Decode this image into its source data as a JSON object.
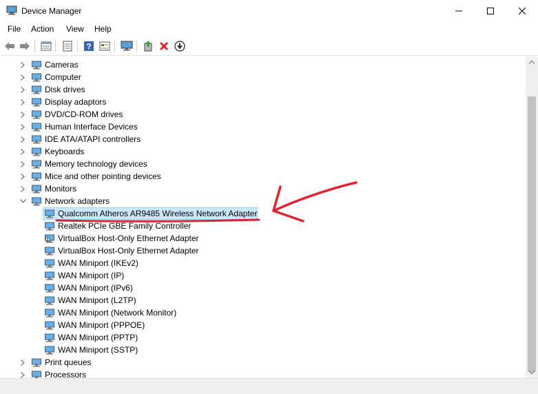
{
  "window": {
    "title": "Device Manager"
  },
  "menu": [
    "File",
    "Action",
    "View",
    "Help"
  ],
  "toolbar": [
    "back-icon",
    "forward-icon",
    "properties-icon",
    "console-icon",
    "help-icon",
    "view-icon",
    "monitor-icon",
    "update-driver-icon",
    "uninstall-icon",
    "disable-icon"
  ],
  "tree": {
    "categories_top": [
      {
        "label": "Cameras",
        "icon": "camera-icon"
      },
      {
        "label": "Computer",
        "icon": "computer-icon"
      },
      {
        "label": "Disk drives",
        "icon": "disk-icon"
      },
      {
        "label": "Display adaptors",
        "icon": "display-icon"
      },
      {
        "label": "DVD/CD-ROM drives",
        "icon": "dvd-icon"
      },
      {
        "label": "Human Interface Devices",
        "icon": "hid-icon"
      },
      {
        "label": "IDE ATA/ATAPI controllers",
        "icon": "ide-icon"
      },
      {
        "label": "Keyboards",
        "icon": "keyboard-icon"
      },
      {
        "label": "Memory technology devices",
        "icon": "memory-icon"
      },
      {
        "label": "Mice and other pointing devices",
        "icon": "mouse-icon"
      },
      {
        "label": "Monitors",
        "icon": "monitor-icon"
      }
    ],
    "expanded": {
      "label": "Network adapters",
      "icon": "network-icon",
      "children": [
        {
          "label": "Qualcomm Atheros AR9485 Wireless Network Adapter",
          "selected": true
        },
        {
          "label": "Realtek PCIe GBE Family Controller"
        },
        {
          "label": "VirtualBox Host-Only Ethernet Adapter",
          "badge": true
        },
        {
          "label": "VirtualBox Host-Only Ethernet Adapter"
        },
        {
          "label": "WAN Miniport (IKEv2)"
        },
        {
          "label": "WAN Miniport (IP)"
        },
        {
          "label": "WAN Miniport (IPv6)"
        },
        {
          "label": "WAN Miniport (L2TP)"
        },
        {
          "label": "WAN Miniport (Network Monitor)"
        },
        {
          "label": "WAN Miniport (PPPOE)"
        },
        {
          "label": "WAN Miniport (PPTP)"
        },
        {
          "label": "WAN Miniport (SSTP)"
        }
      ]
    },
    "categories_bottom": [
      {
        "label": "Print queues",
        "icon": "printer-icon"
      },
      {
        "label": "Processors",
        "icon": "processor-icon"
      }
    ]
  },
  "colors": {
    "selection": "#cce8ff",
    "annotation": "#e0232f"
  }
}
